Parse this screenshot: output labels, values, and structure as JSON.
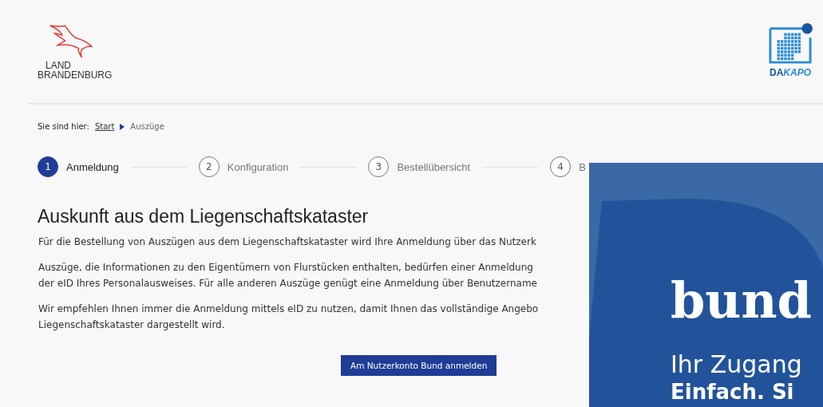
{
  "header": {
    "left_logo": {
      "lines": [
        "LAND",
        "BRANDENBURG"
      ]
    },
    "right_logo": {
      "parts": [
        "DA",
        "KAPO"
      ]
    }
  },
  "breadcrumb": {
    "label": "Sie sind hier:",
    "items": [
      {
        "text": "Start",
        "kind": "link"
      },
      {
        "text": "Auszüge",
        "kind": "current"
      }
    ]
  },
  "steps": [
    {
      "number": "1",
      "label": "Anmeldung",
      "selected": true
    },
    {
      "number": "2",
      "label": "Konfiguration",
      "selected": false
    },
    {
      "number": "3",
      "label": "Bestellübersicht",
      "selected": false
    },
    {
      "number": "4",
      "label": "B",
      "selected": false
    }
  ],
  "heading": "Auskunft aus dem Liegenschaftskataster",
  "paragraphs": [
    [
      "Für die Bestellung von Auszügen aus dem Liegenschaftskataster wird Ihre Anmeldung über das Nutzerk"
    ],
    [
      "Auszüge, die Informationen zu den Eigentümern von Flurstücken enthalten, bedürfen einer Anmeldung",
      "der eID Ihres Personalausweises. Für alle anderen Auszüge genügt eine Anmeldung über Benutzername"
    ],
    [
      "Wir empfehlen Ihnen immer die Anmeldung mittels eID zu nutzen, damit Ihnen das vollständige Angebo",
      "Liegenschaftskataster dargestellt wird."
    ]
  ],
  "login_button": "Am Nutzerkonto Bund anmelden",
  "banner": {
    "title": "bund",
    "subtitle": "Ihr Zugang",
    "tagline": "Einfach. Si"
  }
}
